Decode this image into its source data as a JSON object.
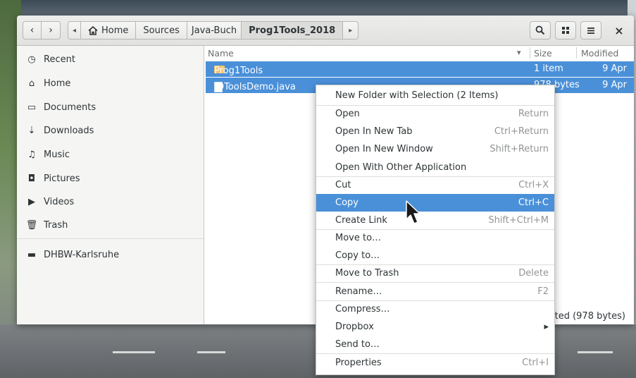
{
  "navigation": {
    "back_icon": "‹",
    "forward_icon": "›"
  },
  "breadcrumb": [
    {
      "label": "◂",
      "icon": "chevron-left-icon"
    },
    {
      "label": "Home",
      "icon": "home-icon"
    },
    {
      "label": "Sources"
    },
    {
      "label": "Java-Buch"
    },
    {
      "label": "Prog1Tools_2018",
      "active": true
    },
    {
      "label": "▸",
      "icon": "chevron-right-icon"
    }
  ],
  "toolbar": {
    "search_icon": "search-icon",
    "view_icon": "grid-view-icon",
    "menu_icon": "menu-icon",
    "close": "×"
  },
  "sidebar": {
    "items": [
      {
        "label": "Recent",
        "icon": "◷"
      },
      {
        "label": "Home",
        "icon": "⌂"
      },
      {
        "label": "Documents",
        "icon": "▭"
      },
      {
        "label": "Downloads",
        "icon": "⇣"
      },
      {
        "label": "Music",
        "icon": "♫"
      },
      {
        "label": "Pictures",
        "icon": "◘"
      },
      {
        "label": "Videos",
        "icon": "▶"
      },
      {
        "label": "Trash",
        "icon": "🗑"
      }
    ],
    "network": [
      {
        "label": "DHBW-Karlsruhe",
        "icon": "▬"
      }
    ]
  },
  "columns": {
    "name": "Name",
    "sort_indicator": "▾",
    "size": "Size",
    "modified": "Modified"
  },
  "files": [
    {
      "name": "Prog1Tools",
      "size": "1 item",
      "modified": "9 Apr"
    },
    {
      "name": "IOToolsDemo.java",
      "size": "978 bytes",
      "modified": "9 Apr"
    }
  ],
  "status": {
    "text": "ected (978 bytes)"
  },
  "context_menu": {
    "items": [
      {
        "label": "New Folder with Selection (2 Items)",
        "accel": ""
      },
      {
        "label": "Open",
        "accel": "Return"
      },
      {
        "label": "Open In New Tab",
        "accel": "Ctrl+Return"
      },
      {
        "label": "Open In New Window",
        "accel": "Shift+Return"
      },
      {
        "label": "Open With Other Application",
        "accel": ""
      },
      {
        "label": "Cut",
        "accel": "Ctrl+X"
      },
      {
        "label": "Copy",
        "accel": "Ctrl+C",
        "highlighted": true
      },
      {
        "label": "Create Link",
        "accel": "Shift+Ctrl+M"
      },
      {
        "label": "Move to…",
        "accel": ""
      },
      {
        "label": "Copy to…",
        "accel": ""
      },
      {
        "label": "Move to Trash",
        "accel": "Delete"
      },
      {
        "label": "Rename…",
        "accel": "F2"
      },
      {
        "label": "Compress…",
        "accel": ""
      },
      {
        "label": "Dropbox",
        "accel": "▸"
      },
      {
        "label": "Send to…",
        "accel": ""
      },
      {
        "label": "Properties",
        "accel": "Ctrl+I"
      }
    ]
  }
}
